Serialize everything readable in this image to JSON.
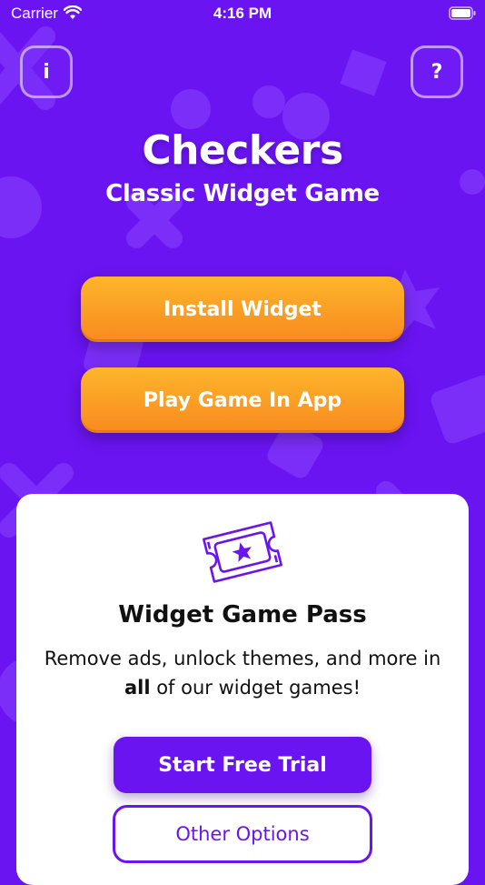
{
  "status_bar": {
    "carrier": "Carrier",
    "time": "4:16 PM"
  },
  "header": {
    "info_label": "i",
    "help_label": "?",
    "title": "Checkers",
    "subtitle": "Classic Widget Game"
  },
  "actions": {
    "install_label": "Install Widget",
    "play_label": "Play Game In App"
  },
  "game_pass": {
    "title": "Widget Game Pass",
    "desc_line1": "Remove ads, unlock themes, and more in",
    "desc_bold": "all",
    "desc_rest": " of our widget games!",
    "trial_label": "Start Free Trial",
    "options_label": "Other Options"
  },
  "colors": {
    "background": "#6a14f2",
    "accent_orange": "#fdb52b",
    "card": "#ffffff"
  },
  "icons": [
    "wifi-icon",
    "battery-icon",
    "ticket-star-icon"
  ]
}
